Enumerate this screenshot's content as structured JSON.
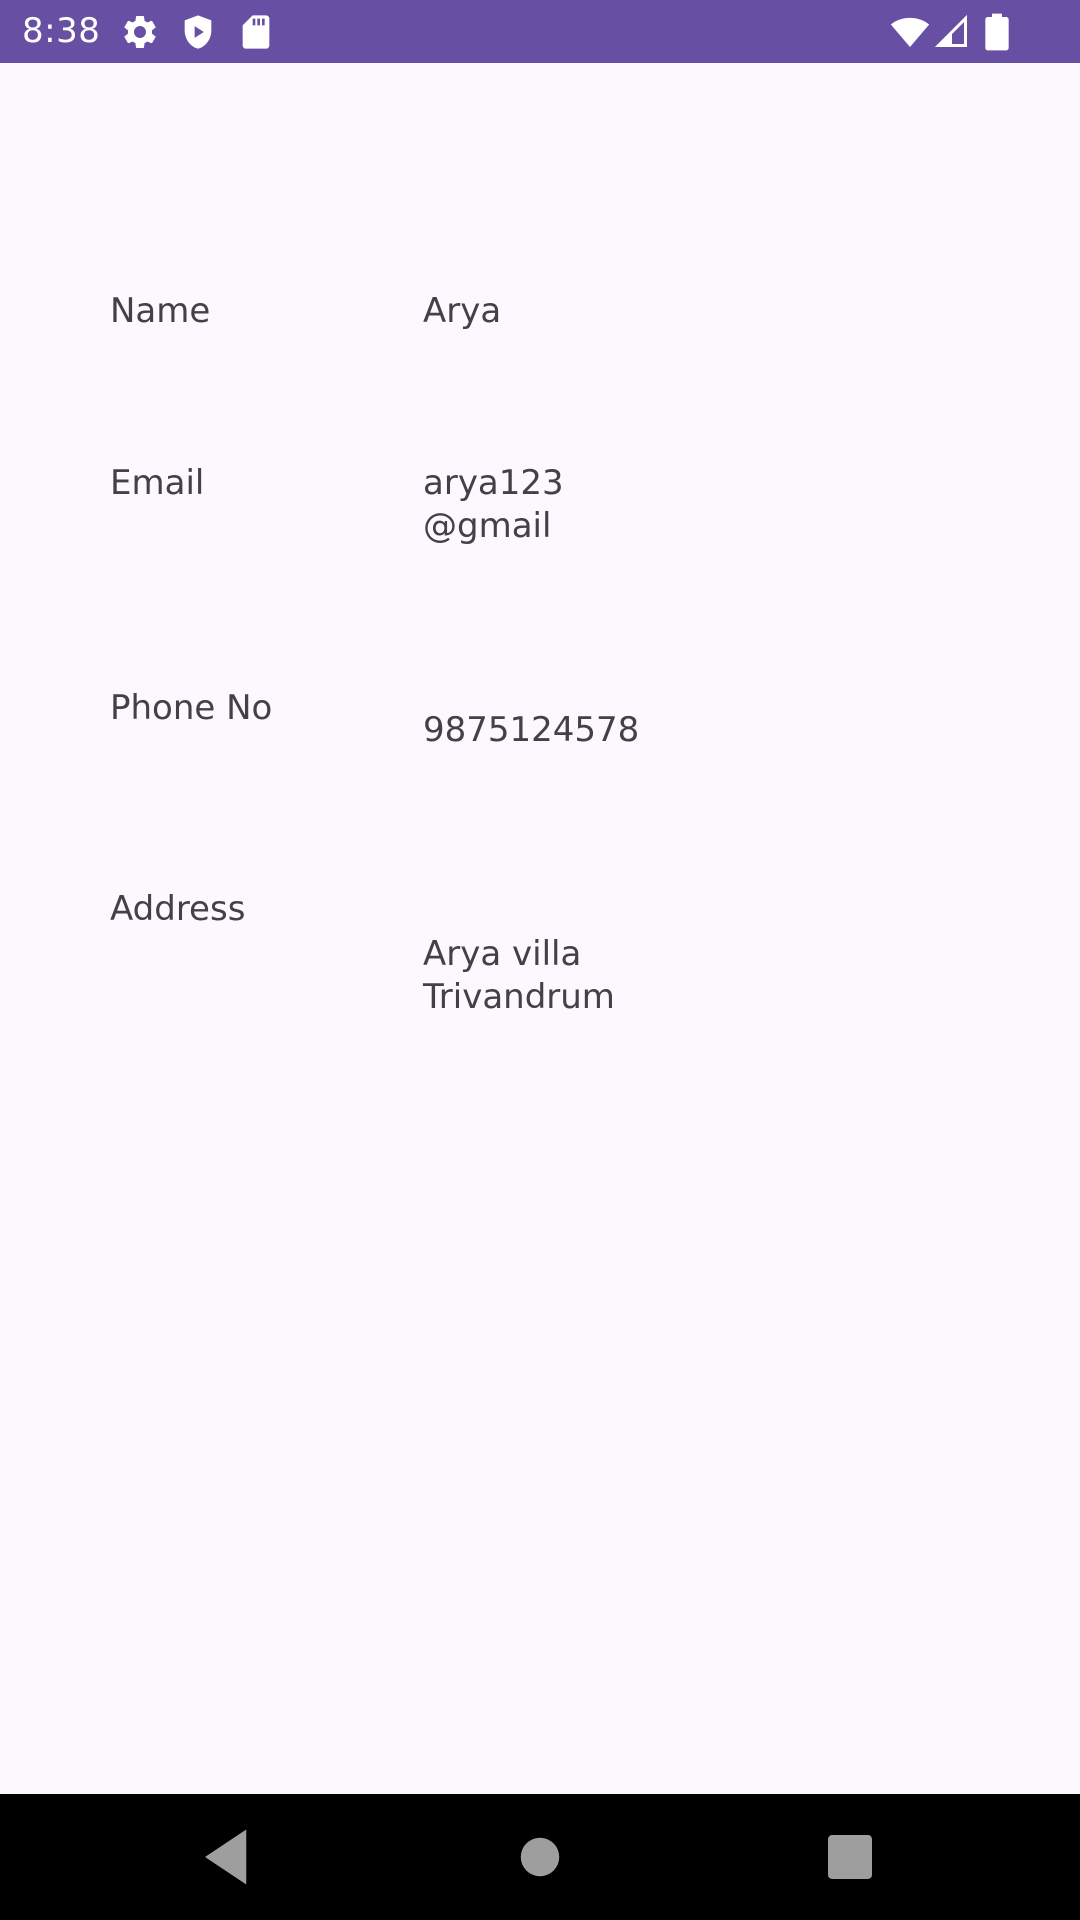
{
  "status_bar": {
    "time": "8:38",
    "background": "#6750a4",
    "left_icons": [
      "gear-icon",
      "shield-icon",
      "sd-card-icon"
    ],
    "right_icons": [
      "wifi-icon",
      "signal-icon",
      "battery-icon"
    ]
  },
  "details": [
    {
      "label": "Name",
      "value": "Arya"
    },
    {
      "label": "Email",
      "value": "arya123\n@gmail"
    },
    {
      "label": "Phone No",
      "value": "9875124578"
    },
    {
      "label": "Address",
      "value": "Arya villa\nTrivandrum"
    }
  ],
  "nav_bar": {
    "buttons": [
      "back-icon",
      "home-icon",
      "recents-icon"
    ]
  },
  "colors": {
    "page_background": "#fdf7fe",
    "text": "#43404a",
    "nav_background": "#000000",
    "nav_icon": "#9e9e9e"
  }
}
